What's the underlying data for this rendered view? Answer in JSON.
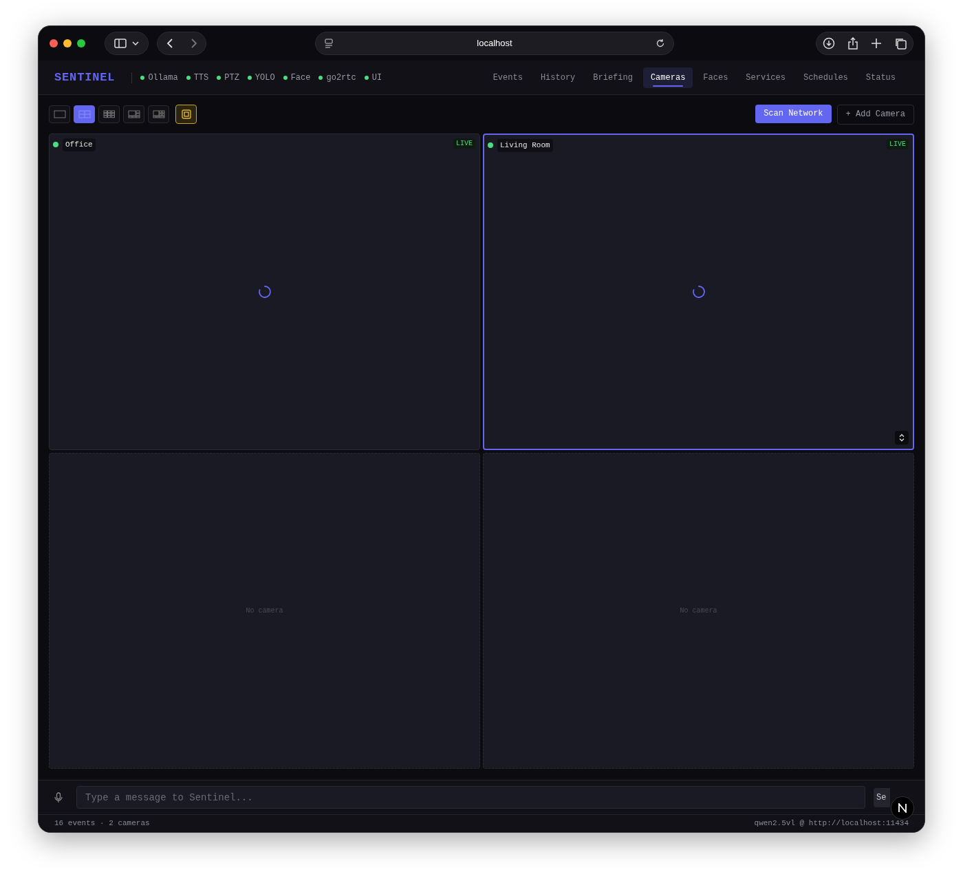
{
  "browser": {
    "address": "localhost"
  },
  "app": {
    "brand": "SENTINEL",
    "services": [
      {
        "name": "Ollama",
        "color": "#4ade80"
      },
      {
        "name": "TTS",
        "color": "#4ade80"
      },
      {
        "name": "PTZ",
        "color": "#4ade80"
      },
      {
        "name": "YOLO",
        "color": "#4ade80"
      },
      {
        "name": "Face",
        "color": "#4ade80"
      },
      {
        "name": "go2rtc",
        "color": "#4ade80"
      },
      {
        "name": "UI",
        "color": "#4ade80"
      }
    ],
    "tabs": [
      {
        "label": "Events",
        "selected": false
      },
      {
        "label": "History",
        "selected": false
      },
      {
        "label": "Briefing",
        "selected": false
      },
      {
        "label": "Cameras",
        "selected": true
      },
      {
        "label": "Faces",
        "selected": false
      },
      {
        "label": "Services",
        "selected": false
      },
      {
        "label": "Schedules",
        "selected": false
      },
      {
        "label": "Status",
        "selected": false
      }
    ]
  },
  "toolbar": {
    "layouts": [
      {
        "kind": "single",
        "selected": false
      },
      {
        "kind": "quad",
        "selected": true
      },
      {
        "kind": "nine",
        "selected": false
      },
      {
        "kind": "onefive",
        "selected": false
      },
      {
        "kind": "oneseven",
        "selected": false
      }
    ],
    "fullscreen": {
      "on": true
    },
    "buttons": [
      {
        "label": "Scan Network",
        "kind": "primary"
      },
      {
        "label": "+ Add Camera",
        "kind": "secondary"
      }
    ]
  },
  "tiles": [
    {
      "kind": "camera",
      "name": "Office",
      "status": "LIVE",
      "selected": false,
      "color": "#4ade80"
    },
    {
      "kind": "camera",
      "name": "Living Room",
      "status": "LIVE",
      "selected": true,
      "color": "#4ade80"
    },
    {
      "kind": "empty",
      "text": "No camera"
    },
    {
      "kind": "empty",
      "text": "No camera"
    }
  ],
  "chat": {
    "placeholder": "Type a message to Sentinel...",
    "send": "Se"
  },
  "status_bar": {
    "left": "16 events · 2 cameras",
    "right": "qwen2.5vl @ http://localhost:11434"
  }
}
